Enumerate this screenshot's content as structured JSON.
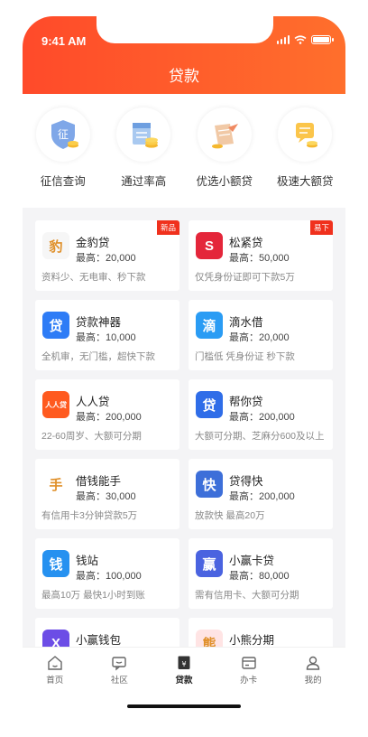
{
  "status_bar": {
    "time": "9:41 AM"
  },
  "header": {
    "title": "贷款"
  },
  "quick_links": [
    {
      "label": "征信查询",
      "icon": "credit-report-icon",
      "glyph": "征"
    },
    {
      "label": "通过率高",
      "icon": "calendar-coins-icon"
    },
    {
      "label": "优选小额贷",
      "icon": "scroll-plane-icon"
    },
    {
      "label": "极速大额贷",
      "icon": "message-coins-icon"
    }
  ],
  "products": [
    {
      "name": "金豹贷",
      "limit": "最高：20,000",
      "desc": "资料少、无电审、秒下款",
      "badge": "新品",
      "logo_color": "#f6f6f6",
      "logo_glyph": "豹"
    },
    {
      "name": "松紧贷",
      "limit": "最高：50,000",
      "desc": "仅凭身份证即可下款5万",
      "badge": "易下",
      "logo_color": "#e4263a",
      "logo_glyph": "S"
    },
    {
      "name": "贷款神器",
      "limit": "最高：10,000",
      "desc": "全机审，无门槛，超快下款",
      "badge": "",
      "logo_color": "#2e7cf6",
      "logo_glyph": "贷"
    },
    {
      "name": "滴水借",
      "limit": "最高：20,000",
      "desc": "门槛低 凭身份证 秒下款",
      "badge": "",
      "logo_color": "#2a9cf4",
      "logo_glyph": "滴"
    },
    {
      "name": "人人贷",
      "limit": "最高：200,000",
      "desc": "22-60周岁、大额可分期",
      "badge": "",
      "logo_color": "#ff5a1f",
      "logo_glyph": "人人贷"
    },
    {
      "name": "帮你贷",
      "limit": "最高：200,000",
      "desc": "大额可分期、芝麻分600及以上",
      "badge": "",
      "logo_color": "#2f6de8",
      "logo_glyph": "贷"
    },
    {
      "name": "借钱能手",
      "limit": "最高：30,000",
      "desc": "有信用卡3分钟贷款5万",
      "badge": "",
      "logo_color": "#ffffff",
      "logo_glyph": "手"
    },
    {
      "name": "贷得快",
      "limit": "最高：200,000",
      "desc": "放款快 最高20万",
      "badge": "",
      "logo_color": "#3d6fd9",
      "logo_glyph": "快"
    },
    {
      "name": "钱站",
      "limit": "最高：100,000",
      "desc": "最高10万 最快1小时到账",
      "badge": "",
      "logo_color": "#2691f0",
      "logo_glyph": "钱"
    },
    {
      "name": "小赢卡贷",
      "limit": "最高：80,000",
      "desc": "需有信用卡、大额可分期",
      "badge": "",
      "logo_color": "#4a63e0",
      "logo_glyph": "赢"
    },
    {
      "name": "小赢钱包",
      "limit": "",
      "desc": "",
      "badge": "",
      "logo_color": "#6c4de6",
      "logo_glyph": "X"
    },
    {
      "name": "小熊分期",
      "limit": "",
      "desc": "",
      "badge": "",
      "logo_color": "#ffe4e4",
      "logo_glyph": "熊"
    }
  ],
  "tabbar": [
    {
      "label": "首页",
      "icon": "home-icon",
      "active": false
    },
    {
      "label": "社区",
      "icon": "community-icon",
      "active": false
    },
    {
      "label": "贷款",
      "icon": "loan-icon",
      "active": true
    },
    {
      "label": "办卡",
      "icon": "card-icon",
      "active": false
    },
    {
      "label": "我的",
      "icon": "profile-icon",
      "active": false
    }
  ],
  "colors": {
    "accent": "#ff4a2a",
    "badge": "#f0311d"
  }
}
